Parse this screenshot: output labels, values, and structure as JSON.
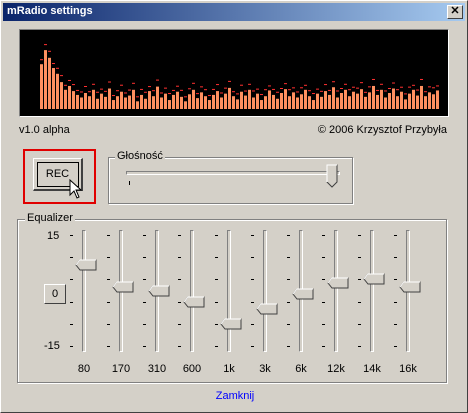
{
  "window": {
    "title": "mRadio settings",
    "close_glyph": "✕"
  },
  "footer": {
    "version": "v1.0 alpha",
    "copyright": "© 2006 Krzysztof Przybyła"
  },
  "rec": {
    "label": "REC"
  },
  "volume": {
    "label": "Głośność",
    "level": 0.99
  },
  "equalizer": {
    "label": "Equalizer",
    "scale_max": "15",
    "scale_min": "-15",
    "reset_label": "0",
    "bands": [
      {
        "label": "80",
        "gain": 7
      },
      {
        "label": "170",
        "gain": 1
      },
      {
        "label": "310",
        "gain": 0
      },
      {
        "label": "600",
        "gain": -3
      },
      {
        "label": "1k",
        "gain": -9
      },
      {
        "label": "3k",
        "gain": -5
      },
      {
        "label": "6k",
        "gain": -1
      },
      {
        "label": "12k",
        "gain": 2
      },
      {
        "label": "14k",
        "gain": 3
      },
      {
        "label": "16k",
        "gain": 1
      }
    ]
  },
  "spectrum": {
    "bar_color": "#ff9060",
    "peak_color": "#ff3030",
    "levels": [
      0.7,
      0.92,
      0.8,
      0.64,
      0.55,
      0.42,
      0.3,
      0.36,
      0.28,
      0.22,
      0.18,
      0.25,
      0.2,
      0.3,
      0.16,
      0.24,
      0.19,
      0.32,
      0.14,
      0.2,
      0.27,
      0.18,
      0.21,
      0.3,
      0.12,
      0.22,
      0.16,
      0.28,
      0.2,
      0.35,
      0.18,
      0.24,
      0.14,
      0.22,
      0.27,
      0.19,
      0.12,
      0.23,
      0.3,
      0.17,
      0.26,
      0.2,
      0.14,
      0.22,
      0.28,
      0.18,
      0.24,
      0.33,
      0.2,
      0.15,
      0.27,
      0.21,
      0.3,
      0.18,
      0.24,
      0.14,
      0.2,
      0.29,
      0.22,
      0.16,
      0.25,
      0.31,
      0.2,
      0.26,
      0.18,
      0.23,
      0.3,
      0.2,
      0.14,
      0.24,
      0.19,
      0.28,
      0.22,
      0.34,
      0.18,
      0.25,
      0.3,
      0.2,
      0.27,
      0.24,
      0.31,
      0.19,
      0.26,
      0.36,
      0.22,
      0.3,
      0.18,
      0.25,
      0.32,
      0.2,
      0.27,
      0.15,
      0.24,
      0.3,
      0.21,
      0.36,
      0.2,
      0.26,
      0.23,
      0.29
    ]
  },
  "close_link": {
    "label": "Zamknij"
  }
}
